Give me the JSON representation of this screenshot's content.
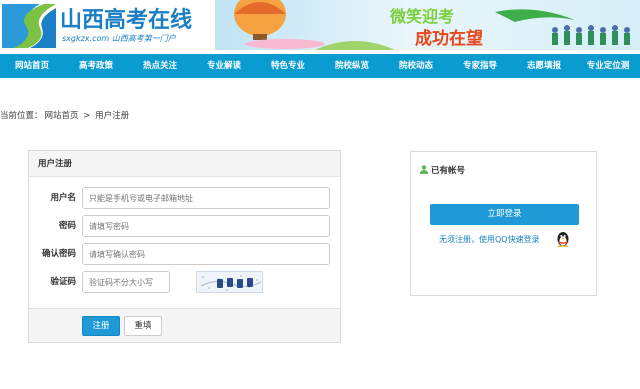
{
  "header": {
    "logo_title": "山西高考在线",
    "logo_subtitle": "sxgkzx.com 山西高考第一门户",
    "banner_slogan_1": "微笑迎考",
    "banner_slogan_2": "成功在望"
  },
  "nav": {
    "items": [
      "网站首页",
      "高考政策",
      "热点关注",
      "专业解读",
      "特色专业",
      "院校纵览",
      "院校动态",
      "专家指导",
      "志愿填报",
      "专业定位测"
    ]
  },
  "breadcrumb": {
    "prefix": "当前位置：",
    "home": "网站首页",
    "separator": ">",
    "current": "用户注册"
  },
  "register": {
    "title": "用户注册",
    "username_label": "用户名",
    "username_placeholder": "只能是手机号或电子邮箱地址",
    "password_label": "密码",
    "password_placeholder": "请填写密码",
    "confirm_label": "确认密码",
    "confirm_placeholder": "请填写确认密码",
    "captcha_label": "验证码",
    "captcha_placeholder": "验证码不分大小写",
    "submit_label": "注册",
    "reset_label": "重填"
  },
  "login": {
    "title": "已有帐号",
    "login_button": "立即登录",
    "qq_link": "无须注册，使用QQ快速登录"
  },
  "colors": {
    "nav_bg": "#0b9ccf",
    "primary_button": "#1f9ad6",
    "logo_blue": "#1a7fc4",
    "slogan_green": "#7ccf3c",
    "slogan_red": "#e8471c"
  }
}
